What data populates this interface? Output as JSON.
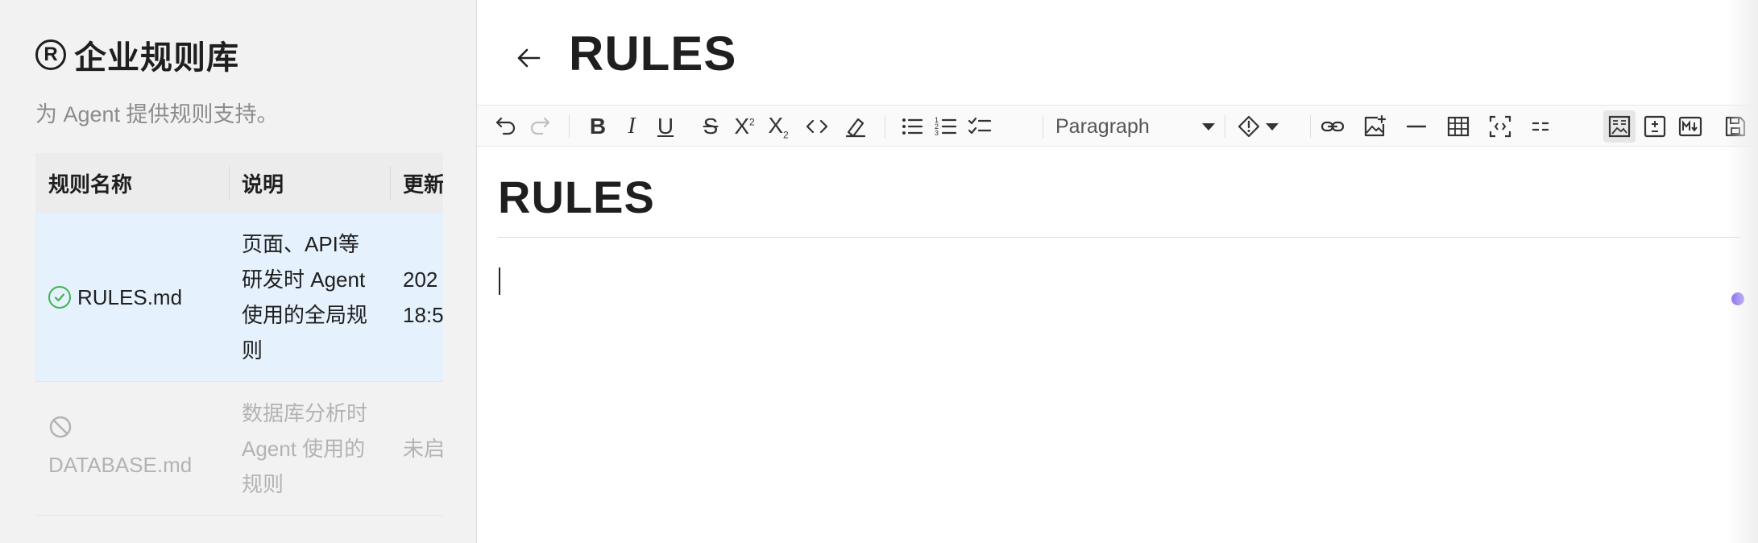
{
  "library": {
    "title": "企业规则库",
    "subtitle": "为 Agent 提供规则支持。"
  },
  "table": {
    "headers": [
      "规则名称",
      "说明",
      "更新"
    ],
    "rows": [
      {
        "name": "RULES.md",
        "status": "enabled",
        "status_icon": "check-circle-icon",
        "description": "页面、API等\n研发时 Agent\n使用的全局规\n则",
        "updated": "202\n18:5"
      },
      {
        "name": "DATABASE.md",
        "status": "disabled",
        "status_icon": "ban-icon",
        "description": "数据库分析时\nAgent 使用的\n规则",
        "updated": "未启"
      }
    ]
  },
  "editor": {
    "title": "RULES",
    "block_type": "Paragraph",
    "document_heading": "RULES"
  },
  "colors": {
    "accent_row": "#e5f1fc",
    "ok_green": "#3fb34f",
    "purple_dot": "#7b5cf0"
  }
}
